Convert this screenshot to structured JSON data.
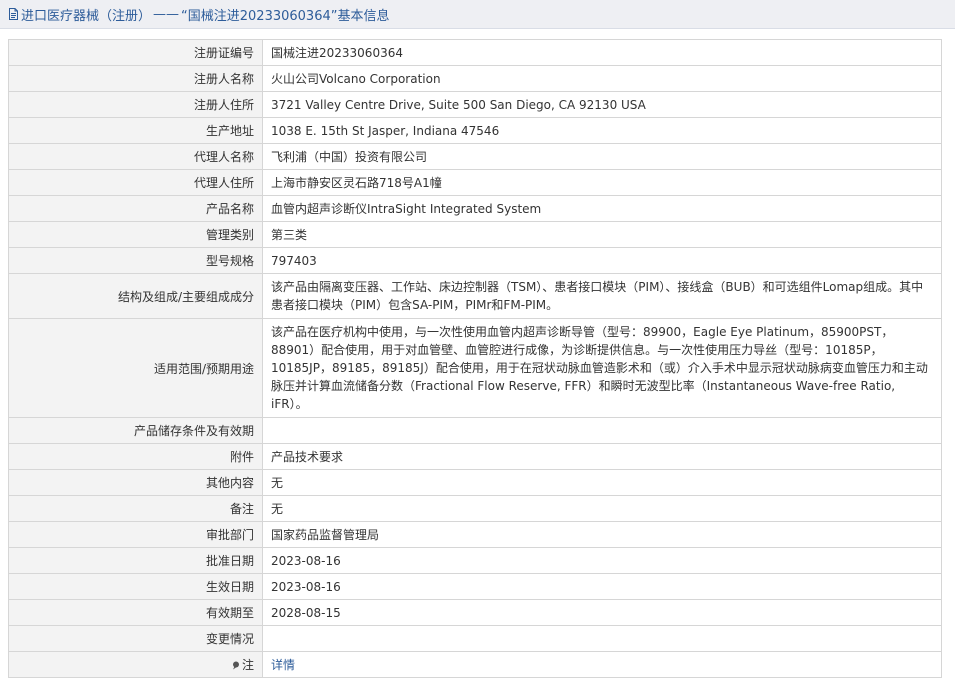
{
  "header": {
    "category": "进口医疗器械（注册）",
    "separator": "——",
    "title": "“国械注进20233060364”基本信息"
  },
  "rows": [
    {
      "label": "注册证编号",
      "value": "国械注进20233060364"
    },
    {
      "label": "注册人名称",
      "value": "火山公司Volcano Corporation"
    },
    {
      "label": "注册人住所",
      "value": "3721 Valley Centre Drive, Suite 500 San Diego, CA 92130 USA"
    },
    {
      "label": "生产地址",
      "value": "1038 E. 15th St Jasper, Indiana 47546"
    },
    {
      "label": "代理人名称",
      "value": "飞利浦（中国）投资有限公司"
    },
    {
      "label": "代理人住所",
      "value": "上海市静安区灵石路718号A1幢"
    },
    {
      "label": "产品名称",
      "value": "血管内超声诊断仪IntraSight Integrated System"
    },
    {
      "label": "管理类别",
      "value": "第三类"
    },
    {
      "label": "型号规格",
      "value": "797403"
    },
    {
      "label": "结构及组成/主要组成成分",
      "value": "该产品由隔离变压器、工作站、床边控制器（TSM）、患者接口模块（PIM）、接线盒（BUB）和可选组件Lomap组成。其中患者接口模块（PIM）包含SA-PIM，PIMr和FM-PIM。"
    },
    {
      "label": "适用范围/预期用途",
      "value": "该产品在医疗机构中使用，与一次性使用血管内超声诊断导管（型号：89900，Eagle Eye Platinum，85900PST，88901）配合使用，用于对血管壁、血管腔进行成像，为诊断提供信息。与一次性使用压力导丝（型号：10185P，10185JP，89185，89185J）配合使用，用于在冠状动脉血管造影术和（或）介入手术中显示冠状动脉病变血管压力和主动脉压并计算血流储备分数（Fractional Flow Reserve, FFR）和瞬时无波型比率（Instantaneous Wave-free Ratio, iFR）。"
    },
    {
      "label": "产品储存条件及有效期",
      "value": ""
    },
    {
      "label": "附件",
      "value": "产品技术要求"
    },
    {
      "label": "其他内容",
      "value": "无"
    },
    {
      "label": "备注",
      "value": "无"
    },
    {
      "label": "审批部门",
      "value": "国家药品监督管理局"
    },
    {
      "label": "批准日期",
      "value": "2023-08-16"
    },
    {
      "label": "生效日期",
      "value": "2023-08-16"
    },
    {
      "label": "有效期至",
      "value": "2028-08-15"
    },
    {
      "label": "变更情况",
      "value": ""
    }
  ],
  "note": {
    "label": "注",
    "link_text": "详情"
  }
}
